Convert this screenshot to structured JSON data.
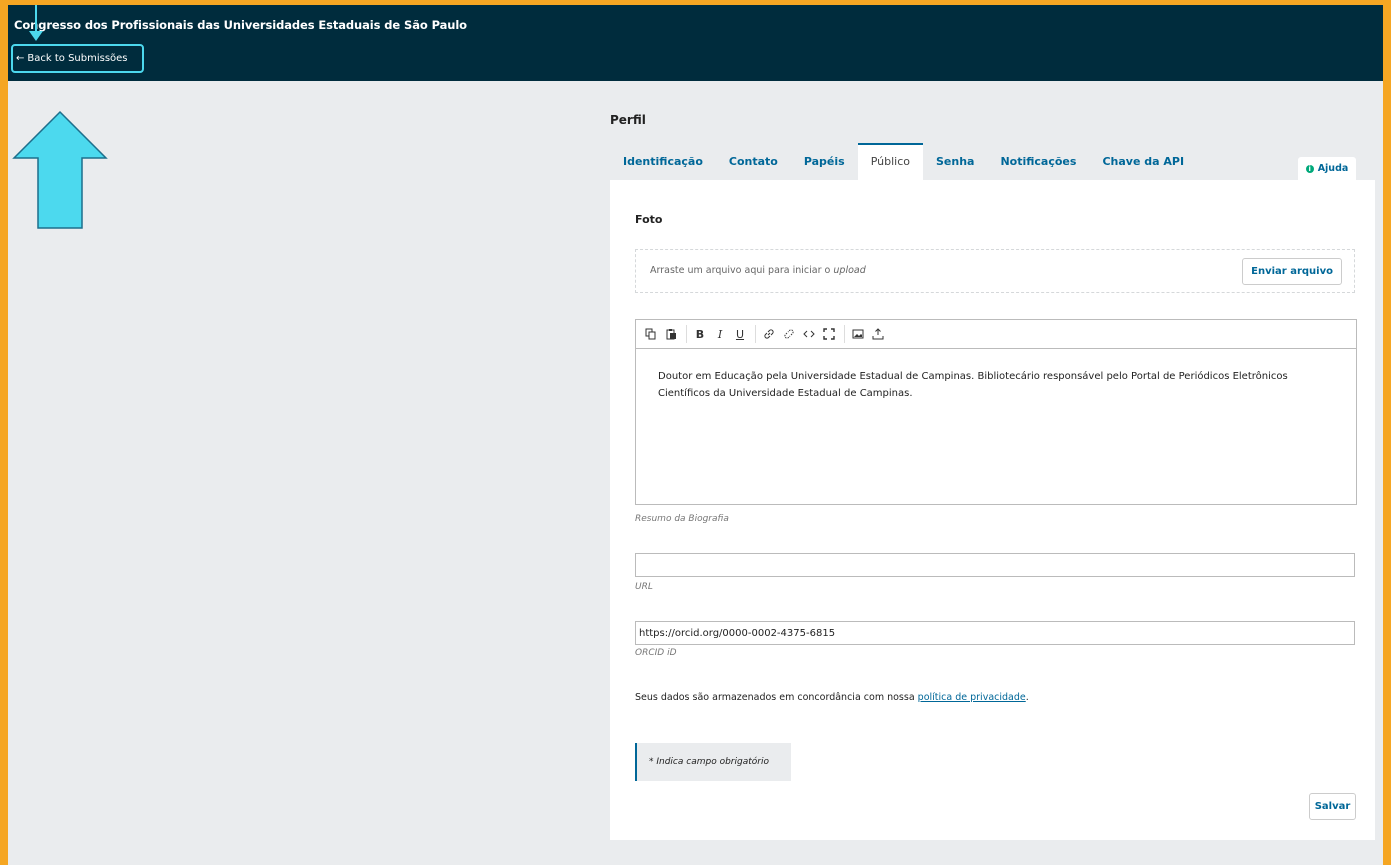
{
  "header": {
    "site_title": "Congresso dos Profissionais das Universidades Estaduais de São Paulo",
    "back_arrow": "←",
    "back_label": "Back to Submissões"
  },
  "page": {
    "heading": "Perfil"
  },
  "tabs": [
    {
      "label": "Identificação",
      "active": false
    },
    {
      "label": "Contato",
      "active": false
    },
    {
      "label": "Papéis",
      "active": false
    },
    {
      "label": "Público",
      "active": true
    },
    {
      "label": "Senha",
      "active": false
    },
    {
      "label": "Notificações",
      "active": false
    },
    {
      "label": "Chave da API",
      "active": false
    }
  ],
  "help": {
    "icon": "info-icon",
    "icon_glyph": "i",
    "label": "Ajuda"
  },
  "photo": {
    "label": "Foto",
    "dropzone_text": "Arraste um arquivo aqui para iniciar o ",
    "dropzone_emphasis": "upload",
    "upload_button": "Enviar arquivo"
  },
  "bio": {
    "toolbar": [
      "copy-icon",
      "paste-icon",
      "bold-icon",
      "italic-icon",
      "underline-icon",
      "link-icon",
      "unlink-icon",
      "code-icon",
      "fullscreen-icon",
      "image-icon",
      "upload-icon"
    ],
    "text": "Doutor em Educação pela Universidade Estadual de Campinas. Bibliotecário responsável pelo Portal de Periódicos Eletrônicos Científicos da Universidade Estadual de Campinas.",
    "caption": "Resumo da Biografia"
  },
  "url_field": {
    "value": "",
    "caption": "URL"
  },
  "orcid_field": {
    "value": "https://orcid.org/0000-0002-4375-6815",
    "caption": "ORCID iD"
  },
  "privacy": {
    "text": "Seus dados são armazenados em concordância com nossa ",
    "link": "política de privacidade",
    "suffix": "."
  },
  "required_note": "* Indica campo obrigatório",
  "save_label": "Salvar",
  "colors": {
    "header_bg": "#002c3d",
    "accent": "#006798",
    "annotation": "#4cd9ee",
    "page_bg": "#eaecee",
    "outer_border": "#f5a623"
  }
}
